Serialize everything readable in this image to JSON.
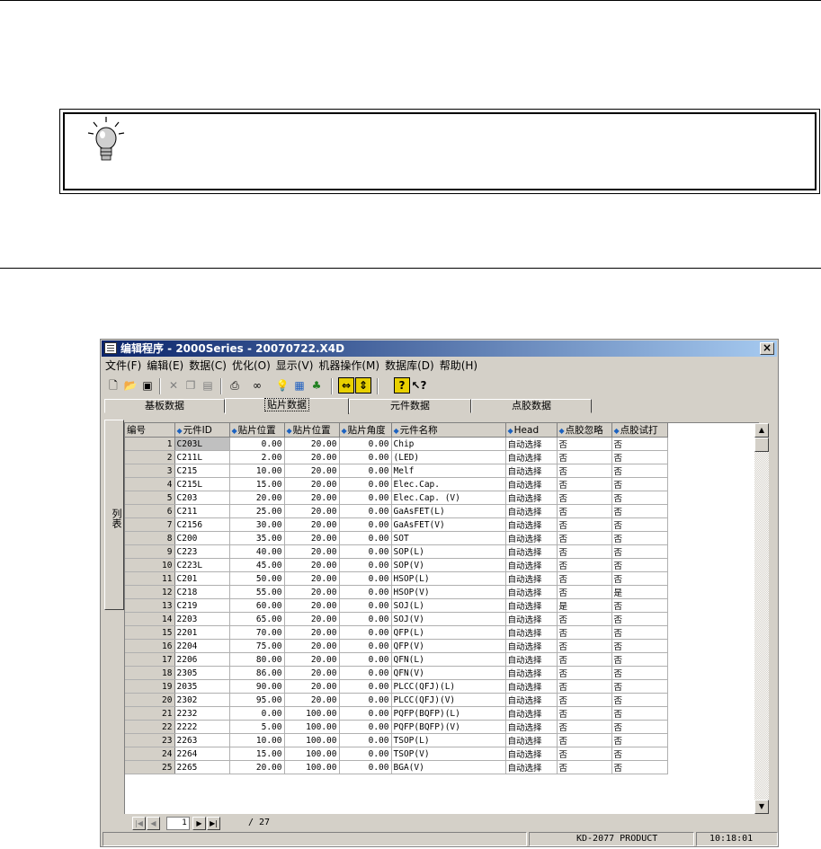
{
  "window": {
    "title": "编辑程序  - 2000Series - 20070722.X4D",
    "close": "×"
  },
  "menu": [
    "文件(F)",
    "编辑(E)",
    "数据(C)",
    "优化(O)",
    "显示(V)",
    "机器操作(M)",
    "数据库(D)",
    "帮助(H)"
  ],
  "toolbar_icons": [
    "new-file-icon",
    "open-folder-icon",
    "save-icon",
    "cut-icon",
    "copy-icon",
    "paste-icon",
    "print-icon",
    "find-icon",
    "bulb-icon",
    "optimize-icon",
    "shapes-icon",
    "fit-width-icon",
    "fit-height-icon",
    "help-icon",
    "context-help-icon"
  ],
  "tabs": [
    "基板数据",
    "贴片数据",
    "元件数据",
    "点胶数据"
  ],
  "side_tab": "列表",
  "columns": [
    "编号",
    "元件ID",
    "贴片位置",
    "贴片位置",
    "贴片角度",
    "元件名称",
    "Head",
    "点胶忽略",
    "点胶试打"
  ],
  "rows": [
    [
      "1",
      "C203L",
      "0.00",
      "20.00",
      "0.00",
      "Chip",
      "自动选择",
      "否",
      "否"
    ],
    [
      "2",
      "C211L",
      "2.00",
      "20.00",
      "0.00",
      "(LED)",
      "自动选择",
      "否",
      "否"
    ],
    [
      "3",
      "C215",
      "10.00",
      "20.00",
      "0.00",
      "Melf",
      "自动选择",
      "否",
      "否"
    ],
    [
      "4",
      "C215L",
      "15.00",
      "20.00",
      "0.00",
      "Elec.Cap.",
      "自动选择",
      "否",
      "否"
    ],
    [
      "5",
      "C203",
      "20.00",
      "20.00",
      "0.00",
      "Elec.Cap. (V)",
      "自动选择",
      "否",
      "否"
    ],
    [
      "6",
      "C211",
      "25.00",
      "20.00",
      "0.00",
      "GaAsFET(L)",
      "自动选择",
      "否",
      "否"
    ],
    [
      "7",
      "C2156",
      "30.00",
      "20.00",
      "0.00",
      "GaAsFET(V)",
      "自动选择",
      "否",
      "否"
    ],
    [
      "8",
      "C200",
      "35.00",
      "20.00",
      "0.00",
      "SOT",
      "自动选择",
      "否",
      "否"
    ],
    [
      "9",
      "C223",
      "40.00",
      "20.00",
      "0.00",
      "SOP(L)",
      "自动选择",
      "否",
      "否"
    ],
    [
      "10",
      "C223L",
      "45.00",
      "20.00",
      "0.00",
      "SOP(V)",
      "自动选择",
      "否",
      "否"
    ],
    [
      "11",
      "C201",
      "50.00",
      "20.00",
      "0.00",
      "HSOP(L)",
      "自动选择",
      "否",
      "否"
    ],
    [
      "12",
      "C218",
      "55.00",
      "20.00",
      "0.00",
      "HSOP(V)",
      "自动选择",
      "否",
      "是"
    ],
    [
      "13",
      "C219",
      "60.00",
      "20.00",
      "0.00",
      "SOJ(L)",
      "自动选择",
      "是",
      "否"
    ],
    [
      "14",
      "2203",
      "65.00",
      "20.00",
      "0.00",
      "SOJ(V)",
      "自动选择",
      "否",
      "否"
    ],
    [
      "15",
      "2201",
      "70.00",
      "20.00",
      "0.00",
      "QFP(L)",
      "自动选择",
      "否",
      "否"
    ],
    [
      "16",
      "2204",
      "75.00",
      "20.00",
      "0.00",
      "QFP(V)",
      "自动选择",
      "否",
      "否"
    ],
    [
      "17",
      "2206",
      "80.00",
      "20.00",
      "0.00",
      "QFN(L)",
      "自动选择",
      "否",
      "否"
    ],
    [
      "18",
      "2305",
      "86.00",
      "20.00",
      "0.00",
      "QFN(V)",
      "自动选择",
      "否",
      "否"
    ],
    [
      "19",
      "2035",
      "90.00",
      "20.00",
      "0.00",
      "PLCC(QFJ)(L)",
      "自动选择",
      "否",
      "否"
    ],
    [
      "20",
      "2302",
      "95.00",
      "20.00",
      "0.00",
      "PLCC(QFJ)(V)",
      "自动选择",
      "否",
      "否"
    ],
    [
      "21",
      "2232",
      "0.00",
      "100.00",
      "0.00",
      "PQFP(BQFP)(L)",
      "自动选择",
      "否",
      "否"
    ],
    [
      "22",
      "2222",
      "5.00",
      "100.00",
      "0.00",
      "PQFP(BQFP)(V)",
      "自动选择",
      "否",
      "否"
    ],
    [
      "23",
      "2263",
      "10.00",
      "100.00",
      "0.00",
      "TSOP(L)",
      "自动选择",
      "否",
      "否"
    ],
    [
      "24",
      "2264",
      "15.00",
      "100.00",
      "0.00",
      "TSOP(V)",
      "自动选择",
      "否",
      "否"
    ],
    [
      "25",
      "2265",
      "20.00",
      "100.00",
      "0.00",
      "BGA(V)",
      "自动选择",
      "否",
      "否"
    ]
  ],
  "pager": {
    "current": "1",
    "total": "/ 27"
  },
  "status": {
    "product": "KD-2077 PRODUCT",
    "time": "10:18:01"
  },
  "colors": {
    "titlebar_start": "#0a246a",
    "titlebar_end": "#a6caf0",
    "sort_icon": "#1c62c0",
    "face": "#d4d0c8"
  }
}
